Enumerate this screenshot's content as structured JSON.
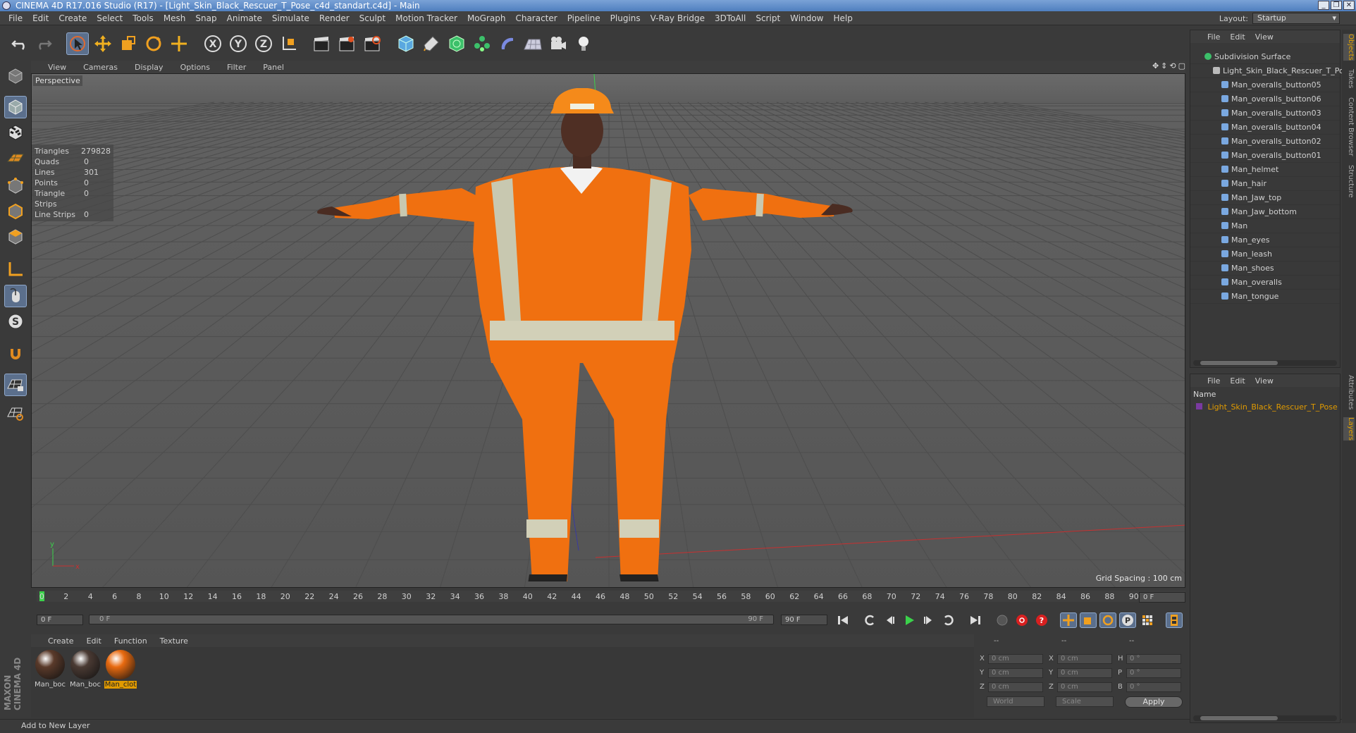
{
  "window": {
    "title": "CINEMA 4D R17.016 Studio (R17) - [Light_Skin_Black_Rescuer_T_Pose_c4d_standart.c4d] - Main",
    "buttons": [
      "_",
      "❐",
      "✕"
    ]
  },
  "menubar": {
    "items": [
      "File",
      "Edit",
      "Create",
      "Select",
      "Tools",
      "Mesh",
      "Snap",
      "Animate",
      "Simulate",
      "Render",
      "Sculpt",
      "Motion Tracker",
      "MoGraph",
      "Character",
      "Pipeline",
      "Plugins",
      "V-Ray Bridge",
      "3DToAll",
      "Script",
      "Window",
      "Help"
    ],
    "layout_label": "Layout:",
    "layout_value": "Startup"
  },
  "viewport": {
    "menu": [
      "View",
      "Cameras",
      "Display",
      "Options",
      "Filter",
      "Panel"
    ],
    "camera_label": "Perspective",
    "stats": [
      {
        "k": "Triangles",
        "v": "279828"
      },
      {
        "k": "Quads",
        "v": "0"
      },
      {
        "k": "Lines",
        "v": "301"
      },
      {
        "k": "Points",
        "v": "0"
      },
      {
        "k": "Triangle Strips",
        "v": "0"
      },
      {
        "k": "Line Strips",
        "v": "0"
      }
    ],
    "grid_spacing": "Grid Spacing : 100 cm",
    "axis_x": "x",
    "axis_y": "y"
  },
  "timeline": {
    "ticks": [
      "0",
      "2",
      "4",
      "6",
      "8",
      "10",
      "12",
      "14",
      "16",
      "18",
      "20",
      "22",
      "24",
      "26",
      "28",
      "30",
      "32",
      "34",
      "36",
      "38",
      "40",
      "42",
      "44",
      "46",
      "48",
      "50",
      "52",
      "54",
      "56",
      "58",
      "60",
      "62",
      "64",
      "66",
      "68",
      "70",
      "72",
      "74",
      "76",
      "78",
      "80",
      "82",
      "84",
      "86",
      "88",
      "90"
    ],
    "current_frame": "0 F",
    "start_frame": "0 F",
    "scrub_start": "0 F",
    "scrub_end": "90 F",
    "end_frame": "90 F"
  },
  "materials": {
    "menu": [
      "Create",
      "Edit",
      "Function",
      "Texture"
    ],
    "items": [
      {
        "label": "Man_boc",
        "color": "#5a3a2a"
      },
      {
        "label": "Man_boc",
        "color": "#4a3a33"
      },
      {
        "label": "Man_clot",
        "color": "#e86a10"
      }
    ]
  },
  "coordinates": {
    "header": [
      "--",
      "--",
      "--"
    ],
    "rows": [
      {
        "a": "X",
        "av": "0 cm",
        "b": "X",
        "bv": "0 cm",
        "c": "H",
        "cv": "0 °"
      },
      {
        "a": "Y",
        "av": "0 cm",
        "b": "Y",
        "bv": "0 cm",
        "c": "P",
        "cv": "0 °"
      },
      {
        "a": "Z",
        "av": "0 cm",
        "b": "Z",
        "bv": "0 cm",
        "c": "B",
        "cv": "0 °"
      }
    ],
    "mode": "World",
    "scale": "Scale",
    "apply": "Apply"
  },
  "status": "Add to New Layer",
  "object_manager": {
    "menu": [
      "File",
      "Edit",
      "View"
    ],
    "root": "Subdivision Surface",
    "group": "Light_Skin_Black_Rescuer_T_Pose",
    "children": [
      "Man_overalls_button05",
      "Man_overalls_button06",
      "Man_overalls_button03",
      "Man_overalls_button04",
      "Man_overalls_button02",
      "Man_overalls_button01",
      "Man_helmet",
      "Man_hair",
      "Man_Jaw_top",
      "Man_Jaw_bottom",
      "Man",
      "Man_eyes",
      "Man_leash",
      "Man_shoes",
      "Man_overalls",
      "Man_tongue"
    ]
  },
  "layer_manager": {
    "menu": [
      "File",
      "Edit",
      "View"
    ],
    "header": "Name",
    "row": "Light_Skin_Black_Rescuer_T_Pose"
  },
  "right_tabs": [
    "Objects",
    "Takes",
    "Content Browser",
    "Structure",
    "Attributes",
    "Layers"
  ],
  "colors": {
    "accent_select": "#5b6f8c",
    "playhead": "#3bd24b",
    "orange_highlight": "#e09a00",
    "rescuer_suit": "#f07010"
  }
}
